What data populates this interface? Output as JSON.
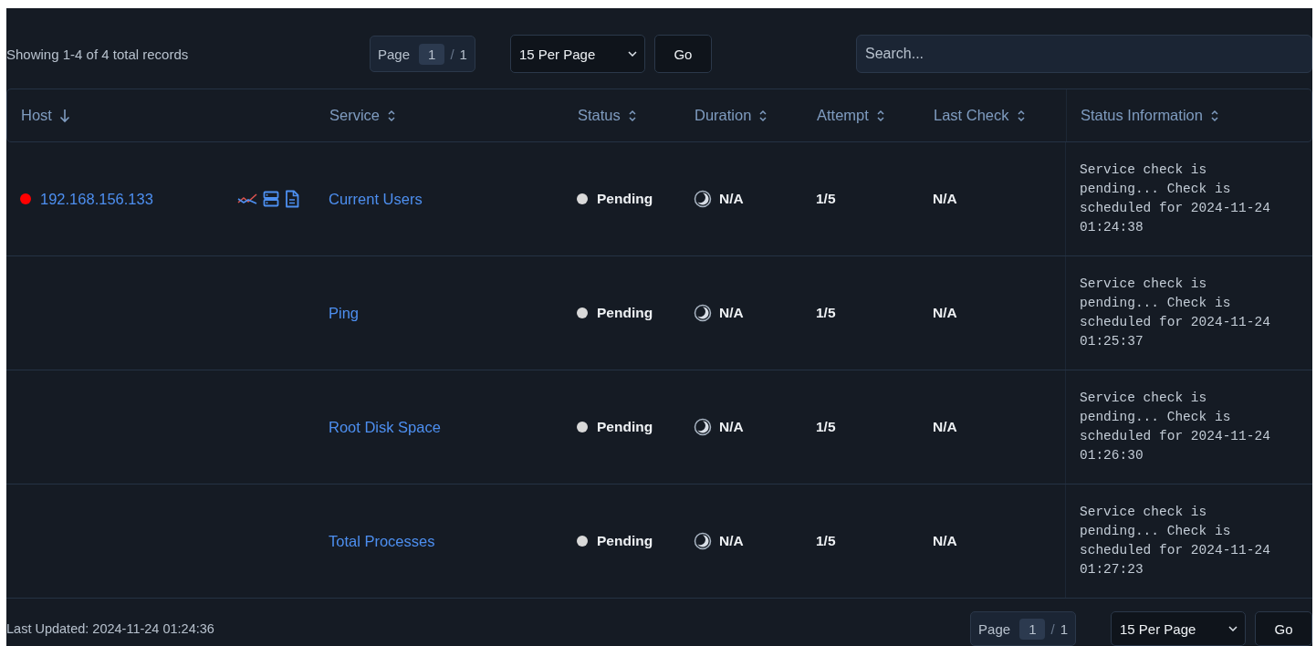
{
  "toolbar": {
    "summary": "Showing 1-4 of 4 total records",
    "pager": {
      "label": "Page",
      "current": "1",
      "separator": "/",
      "total": "1"
    },
    "per_page": "15 Per Page",
    "go": "Go",
    "search": {
      "placeholder": "Search..."
    }
  },
  "table": {
    "columns": [
      {
        "label": "Host",
        "sorted": true
      },
      {
        "label": "Service",
        "sorted": false
      },
      {
        "label": "Status",
        "sorted": false
      },
      {
        "label": "Duration",
        "sorted": false
      },
      {
        "label": "Attempt",
        "sorted": false
      },
      {
        "label": "Last Check",
        "sorted": false
      },
      {
        "label": "Status Information",
        "sorted": false
      }
    ],
    "rows": [
      {
        "host": {
          "text": "192.168.156.133",
          "color": "#ff0000"
        },
        "service": "Current Users",
        "status": {
          "text": "Pending",
          "color": "#d9d9d9"
        },
        "duration": "N/A",
        "attempt": "1/5",
        "last_check": "N/A",
        "info": "Service check is pending... Check is scheduled for 2024-11-24 01:24:38"
      },
      {
        "service": "Ping",
        "status": {
          "text": "Pending",
          "color": "#d9d9d9"
        },
        "duration": "N/A",
        "attempt": "1/5",
        "last_check": "N/A",
        "info": "Service check is pending... Check is scheduled for 2024-11-24 01:25:37"
      },
      {
        "service": "Root Disk Space",
        "status": {
          "text": "Pending",
          "color": "#d9d9d9"
        },
        "duration": "N/A",
        "attempt": "1/5",
        "last_check": "N/A",
        "info": "Service check is pending... Check is scheduled for 2024-11-24 01:26:30"
      },
      {
        "service": "Total Processes",
        "status": {
          "text": "Pending",
          "color": "#d9d9d9"
        },
        "duration": "N/A",
        "attempt": "1/5",
        "last_check": "N/A",
        "info": "Service check is pending... Check is scheduled for 2024-11-24 01:27:23"
      }
    ]
  },
  "footer": {
    "last_updated": "Last Updated: 2024-11-24 01:24:36",
    "pager": {
      "label": "Page",
      "current": "1",
      "separator": "/",
      "total": "1"
    },
    "per_page": "15 Per Page",
    "go": "Go"
  }
}
